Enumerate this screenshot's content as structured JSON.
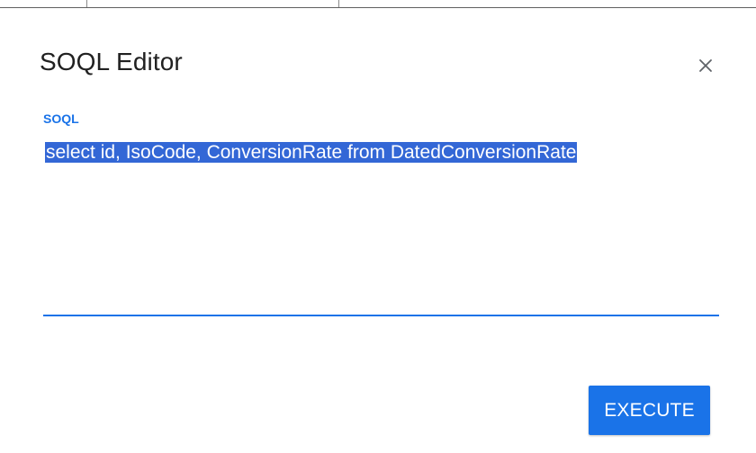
{
  "dialog": {
    "title": "SOQL Editor",
    "close_icon": "close-icon",
    "query_field": {
      "label": "SOQL",
      "value": "select id, IsoCode, ConversionRate from DatedConversionRate",
      "selected": true
    },
    "execute_label": "EXECUTE"
  },
  "colors": {
    "accent": "#1a73e8",
    "selection": "#3367d6",
    "title_text": "#212121"
  }
}
